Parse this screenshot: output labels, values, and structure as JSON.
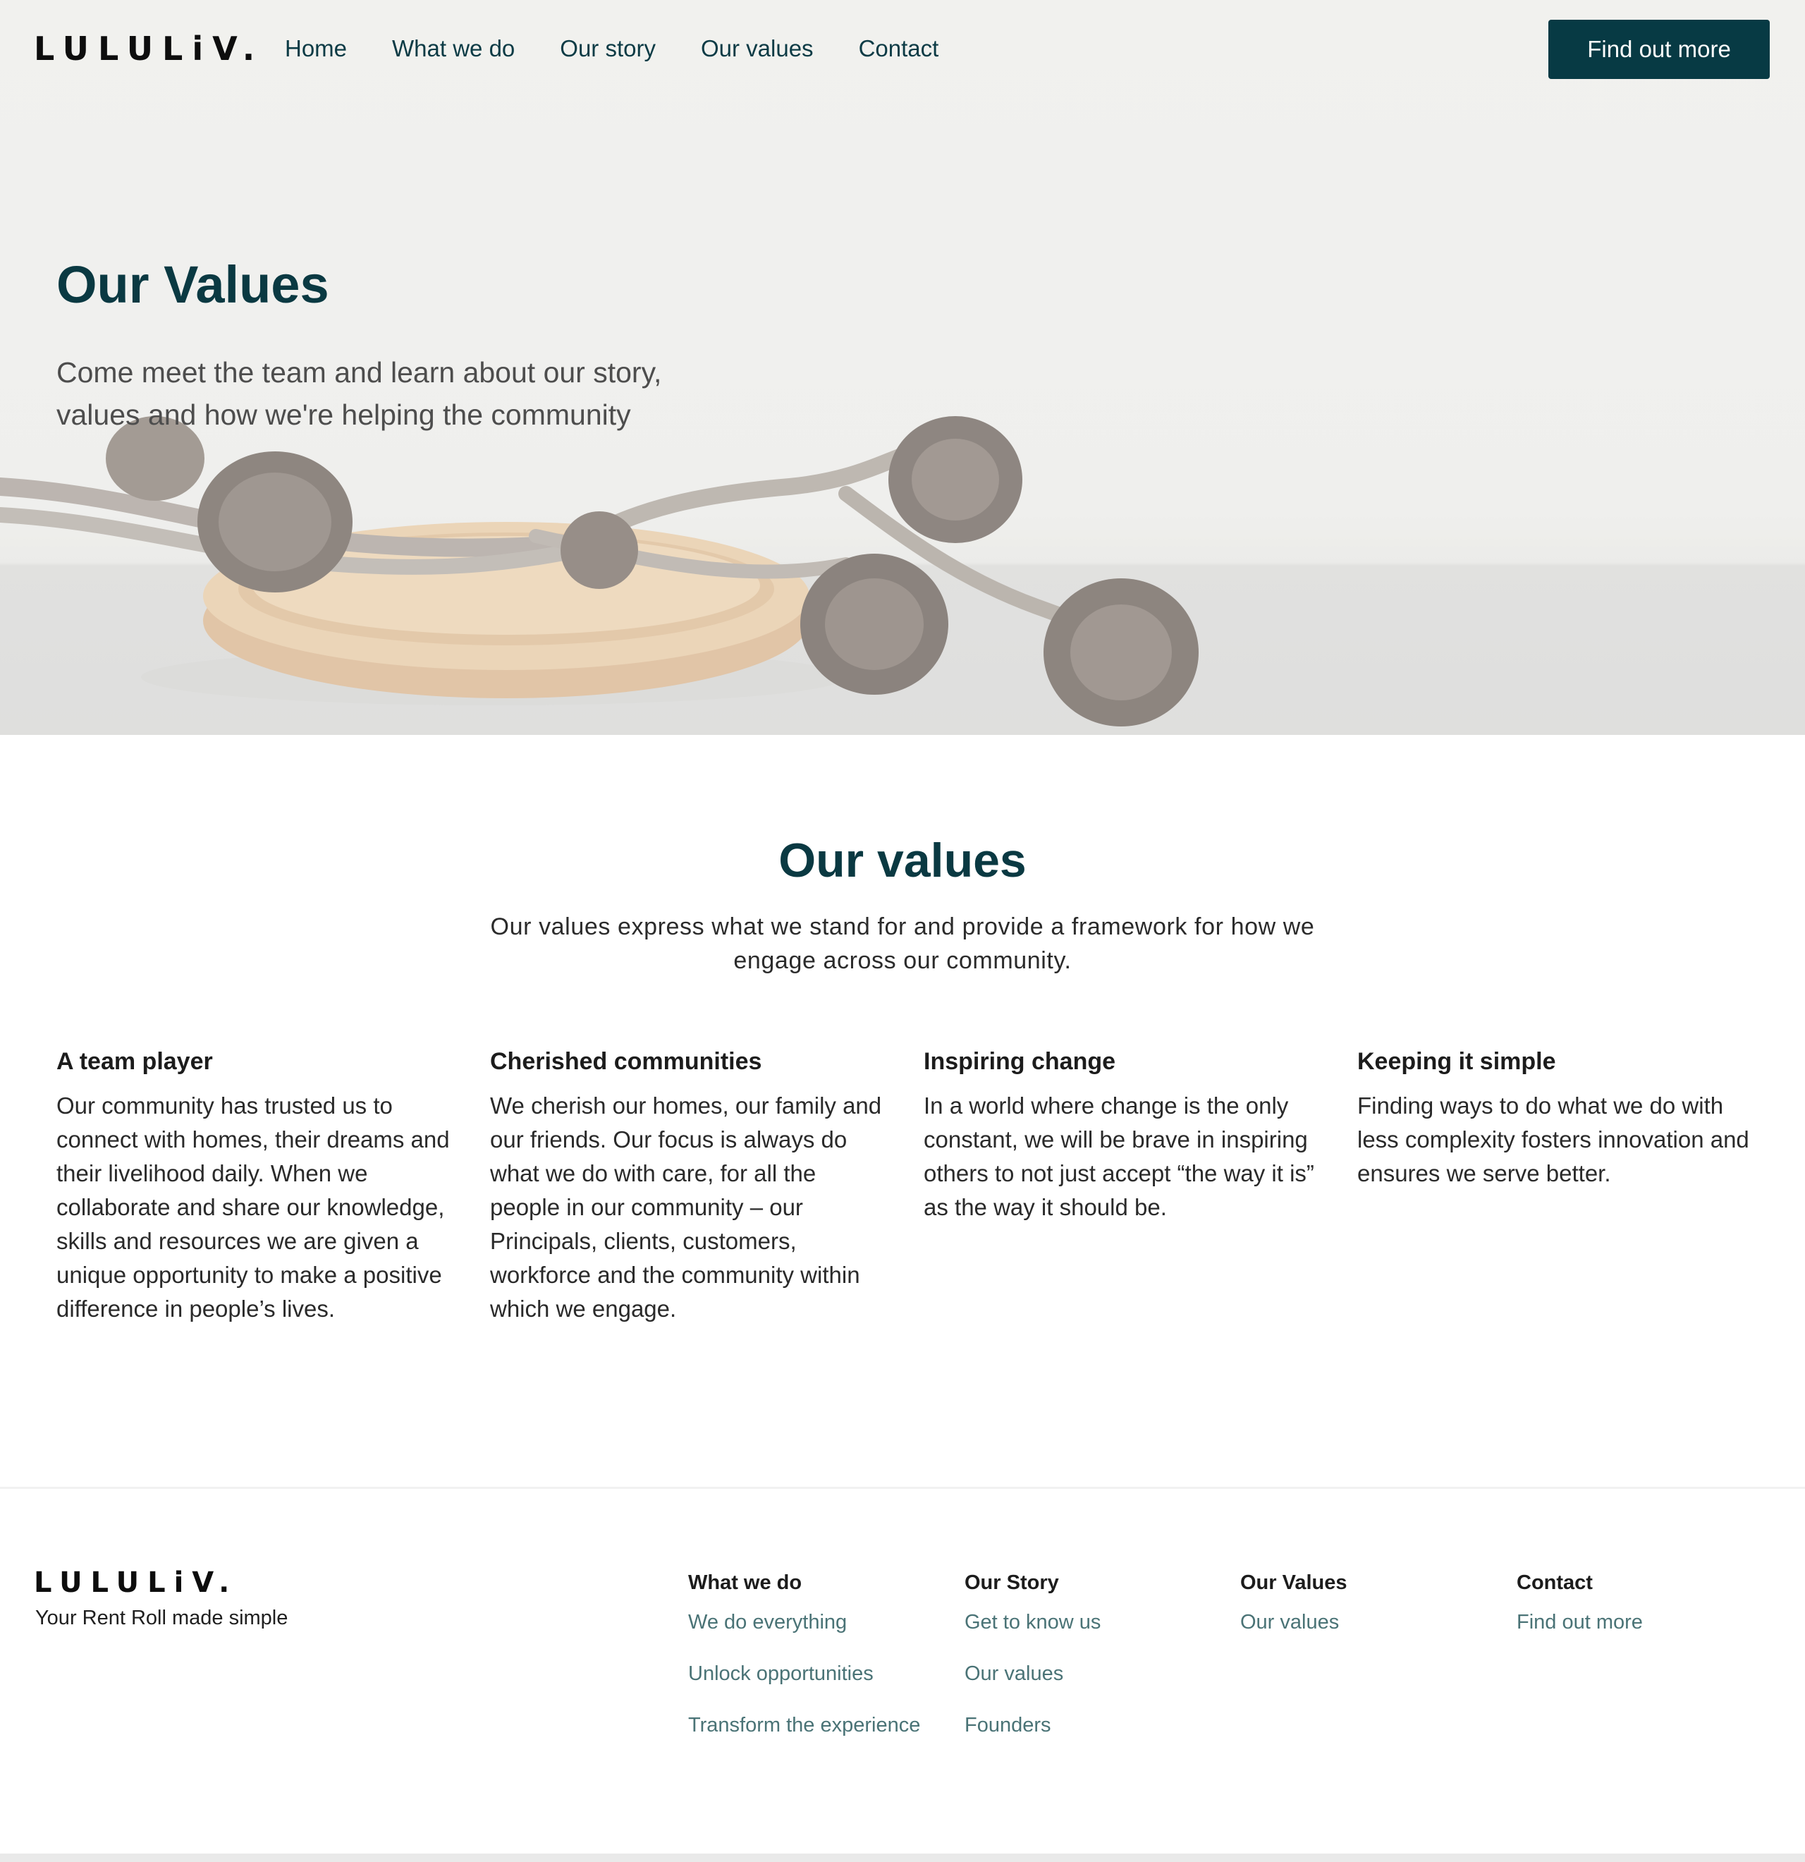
{
  "brand": {
    "logo": "LULULiV.",
    "tagline": "Your Rent Roll made simple"
  },
  "nav": {
    "items": [
      "Home",
      "What we do",
      "Our story",
      "Our values",
      "Contact"
    ],
    "cta": "Find out more"
  },
  "hero": {
    "title": "Our Values",
    "subtitle": "Come meet the team and learn about our story, values and how we're helping the community",
    "image": "pinecones-on-wooden-plate"
  },
  "values": {
    "title": "Our values",
    "intro": "Our values express what we stand for and provide a framework for how we engage across our community.",
    "items": [
      {
        "title": "A team player",
        "text": "Our community has trusted us to connect with homes, their dreams and their livelihood daily. When we collaborate and share our knowledge, skills and resources we are given a unique opportunity to make a positive difference in people’s lives."
      },
      {
        "title": "Cherished communities",
        "text": "We cherish our homes, our family and our friends. Our focus is always do what we do with care, for all the people in our community – our Principals, clients, customers, workforce and the community within which we engage."
      },
      {
        "title": "Inspiring change",
        "text": "In a world where change is the only constant, we will be brave in inspiring others to not just accept “the way it is” as the way it should be."
      },
      {
        "title": "Keeping it simple",
        "text": "Finding ways to do what we do with less complexity fosters innovation and ensures we serve better."
      }
    ]
  },
  "footer": {
    "columns": [
      {
        "title": "What we do",
        "links": [
          "We do everything",
          "Unlock opportunities",
          "Transform the experience"
        ]
      },
      {
        "title": "Our Story",
        "links": [
          "Get to know us",
          "Our values",
          "Founders"
        ]
      },
      {
        "title": "Our Values",
        "links": [
          "Our values"
        ]
      },
      {
        "title": "Contact",
        "links": [
          "Find out more"
        ]
      }
    ]
  },
  "colors": {
    "primary": "#073a44",
    "link": "#4a7376",
    "text": "#1f1f1f"
  }
}
